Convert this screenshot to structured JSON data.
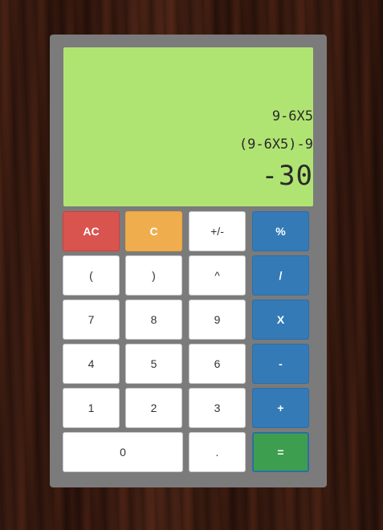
{
  "display": {
    "history": "9-6X5",
    "expression": "(9-6X5)-9",
    "result": "-30"
  },
  "keys": {
    "ac": "AC",
    "c": "C",
    "plus_minus": "+/-",
    "percent": "%",
    "open_paren": "(",
    "close_paren": ")",
    "power": "^",
    "divide": "/",
    "seven": "7",
    "eight": "8",
    "nine": "9",
    "multiply": "X",
    "four": "4",
    "five": "5",
    "six": "6",
    "minus": "-",
    "one": "1",
    "two": "2",
    "three": "3",
    "plus": "+",
    "zero": "0",
    "decimal": ".",
    "equals": "="
  },
  "colors": {
    "display_bg": "#b0e472",
    "clear_all": "#d9534f",
    "clear": "#f0ad4e",
    "operator": "#337ab7",
    "equals": "#3e9e4f",
    "body": "#7b7b7b"
  }
}
